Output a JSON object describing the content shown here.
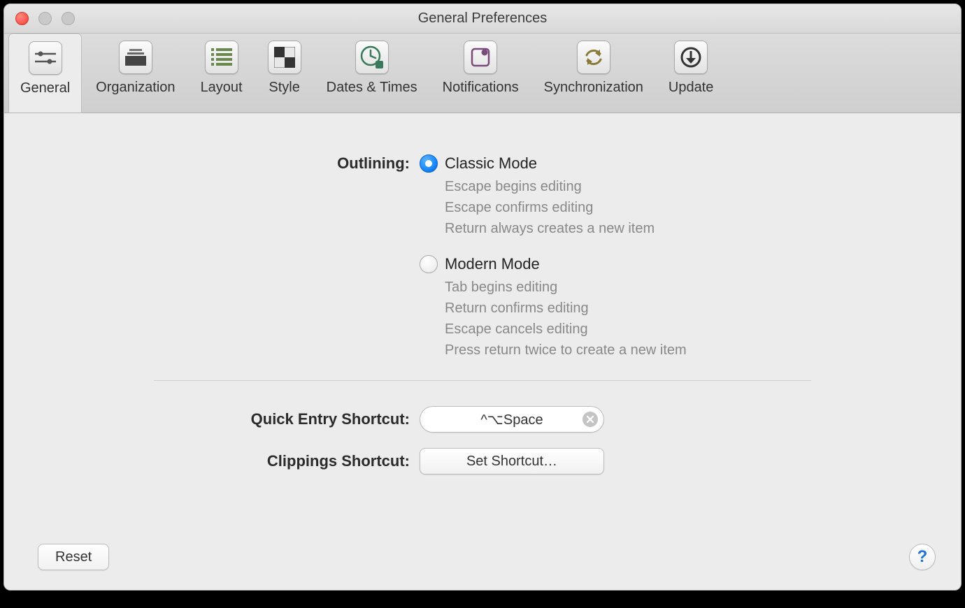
{
  "window": {
    "title": "General Preferences"
  },
  "toolbar": {
    "tabs": [
      {
        "label": "General"
      },
      {
        "label": "Organization"
      },
      {
        "label": "Layout"
      },
      {
        "label": "Style"
      },
      {
        "label": "Dates & Times"
      },
      {
        "label": "Notifications"
      },
      {
        "label": "Synchronization"
      },
      {
        "label": "Update"
      }
    ]
  },
  "outlining": {
    "label": "Outlining:",
    "options": [
      {
        "title": "Classic Mode",
        "hints": [
          "Escape begins editing",
          "Escape confirms editing",
          "Return always creates a new item"
        ]
      },
      {
        "title": "Modern Mode",
        "hints": [
          "Tab begins editing",
          "Return confirms editing",
          "Escape cancels editing",
          "Press return twice to create a new item"
        ]
      }
    ]
  },
  "shortcuts": {
    "quick_entry_label": "Quick Entry Shortcut:",
    "quick_entry_value": "^⌥Space",
    "clippings_label": "Clippings Shortcut:",
    "clippings_button": "Set Shortcut…"
  },
  "footer": {
    "reset": "Reset",
    "help": "?"
  }
}
